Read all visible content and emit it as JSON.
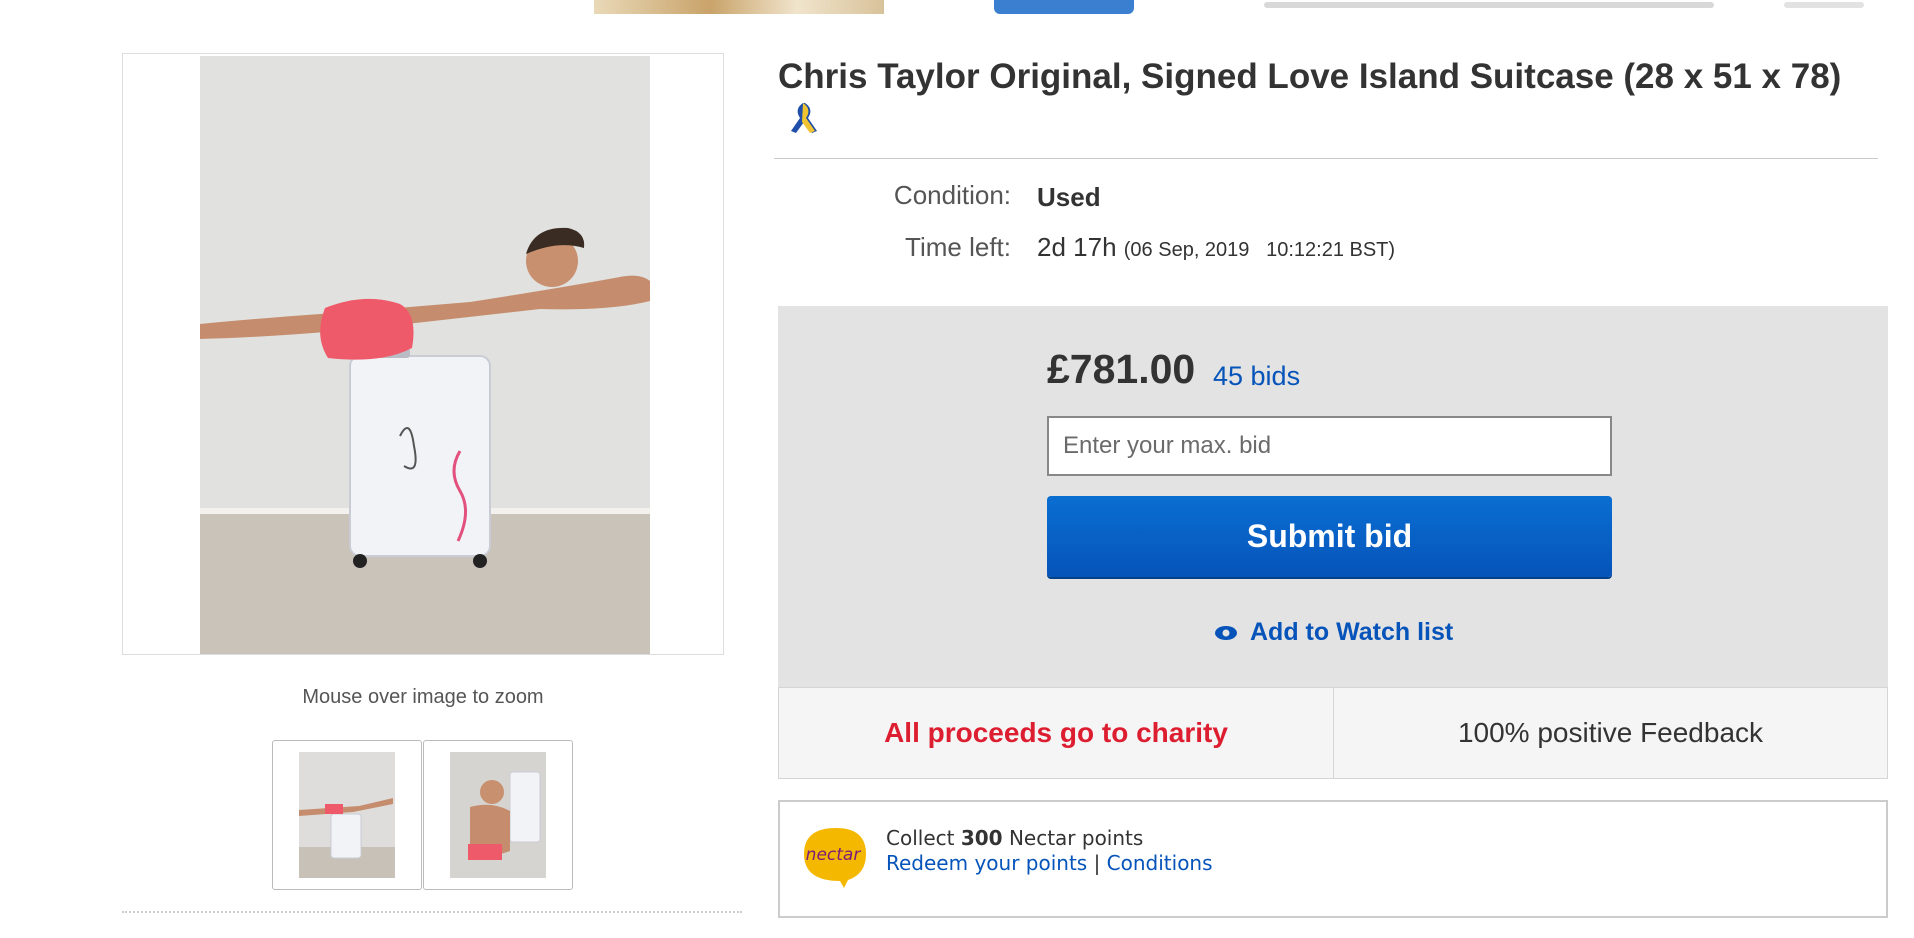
{
  "listing": {
    "title": "Chris Taylor Original, Signed Love Island Suitcase (28 x 51 x 78)",
    "zoom_hint": "Mouse over image to zoom",
    "condition_label": "Condition:",
    "condition_value": "Used",
    "time_left_label": "Time left:",
    "time_left_value": "2d 17h",
    "time_left_end": "(06 Sep, 2019   10:12:21 BST)"
  },
  "bidding": {
    "price": "£781.00",
    "bids": "45 bids",
    "bid_placeholder": "Enter your max. bid",
    "submit_label": "Submit bid",
    "watch_label": "Add to Watch list"
  },
  "info": {
    "charity": "All proceeds go to charity",
    "feedback": "100% positive Feedback"
  },
  "nectar": {
    "logo_text": "nectar",
    "collect_prefix": "Collect",
    "points": "300",
    "collect_suffix": "Nectar points",
    "redeem": "Redeem your points",
    "separator": "|",
    "conditions": "Conditions"
  },
  "icons": {
    "ribbon": "charity-ribbon-icon",
    "watch": "eye-icon"
  },
  "colors": {
    "link": "#0654ba",
    "button": "#0654ba",
    "charity_red": "#dd1e31",
    "panel_gray": "#e3e3e3"
  }
}
